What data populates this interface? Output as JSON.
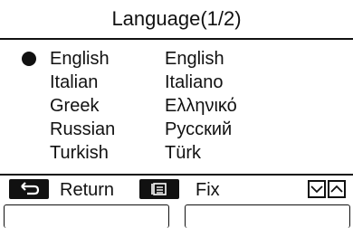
{
  "header": {
    "title": "Language(1/2)"
  },
  "languages": [
    {
      "english": "English",
      "native": "English",
      "selected": true
    },
    {
      "english": "Italian",
      "native": "Italiano",
      "selected": false
    },
    {
      "english": "Greek",
      "native": "Ελληνικό",
      "selected": false
    },
    {
      "english": "Russian",
      "native": "Русский",
      "selected": false
    },
    {
      "english": "Turkish",
      "native": "Türk",
      "selected": false
    }
  ],
  "footer": {
    "return_label": "Return",
    "return_icon": "return-arrow-icon",
    "fix_label": "Fix",
    "fix_icon": "menu-list-icon",
    "down_icon": "chevron-down-icon",
    "up_icon": "chevron-up-icon"
  }
}
